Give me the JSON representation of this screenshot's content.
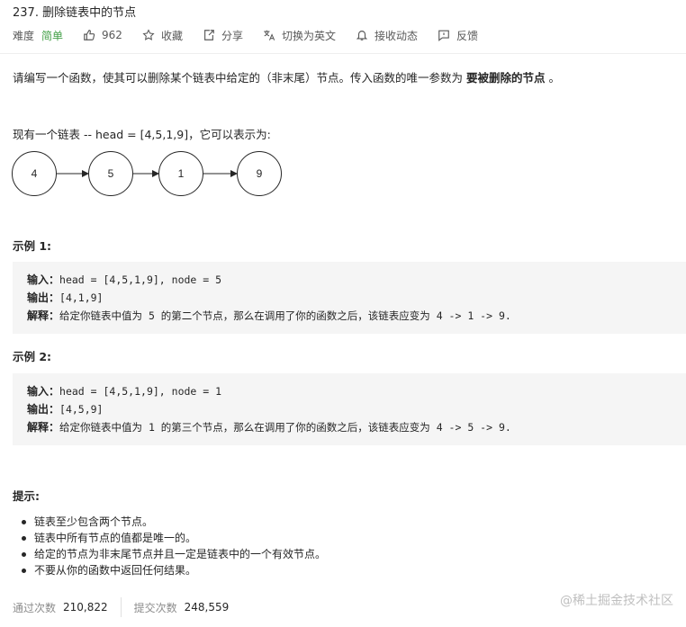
{
  "problem": {
    "title": "237. 删除链表中的节点",
    "difficulty_label": "难度",
    "difficulty": "简单",
    "likes": "962",
    "collect": "收藏",
    "share": "分享",
    "switch_lang": "切换为英文",
    "notify": "接收动态",
    "feedback": "反馈"
  },
  "description": {
    "text": "请编写一个函数，使其可以删除某个链表中给定的（非末尾）节点。传入函数的唯一参数为 ",
    "bold": "要被删除的节点",
    "end": " 。",
    "list_intro": "现有一个链表 -- head = [4,5,1,9]，它可以表示为:"
  },
  "diagram": {
    "nodes": [
      "4",
      "5",
      "1",
      "9"
    ]
  },
  "examples": [
    {
      "heading": "示例 1:",
      "input_label": "输入：",
      "input": "head = [4,5,1,9], node = 5",
      "output_label": "输出：",
      "output": "[4,1,9]",
      "explain_label": "解释：",
      "explain": "给定你链表中值为 5 的第二个节点，那么在调用了你的函数之后，该链表应变为 4 -> 1 -> 9."
    },
    {
      "heading": "示例 2:",
      "input_label": "输入：",
      "input": "head = [4,5,1,9], node = 1",
      "output_label": "输出：",
      "output": "[4,5,9]",
      "explain_label": "解释：",
      "explain": "给定你链表中值为 1 的第三个节点，那么在调用了你的函数之后，该链表应变为 4 -> 5 -> 9."
    }
  ],
  "hints": {
    "heading": "提示:",
    "items": [
      "链表至少包含两个节点。",
      "链表中所有节点的值都是唯一的。",
      "给定的节点为非末尾节点并且一定是链表中的一个有效节点。",
      "不要从你的函数中返回任何结果。"
    ]
  },
  "stats": {
    "accepted_label": "通过次数",
    "accepted": "210,822",
    "submissions_label": "提交次数",
    "submissions": "248,559"
  },
  "watermark": "@稀土掘金技术社区",
  "colors": {
    "easy": "#43a047",
    "code_bg": "#f5f5f5"
  }
}
